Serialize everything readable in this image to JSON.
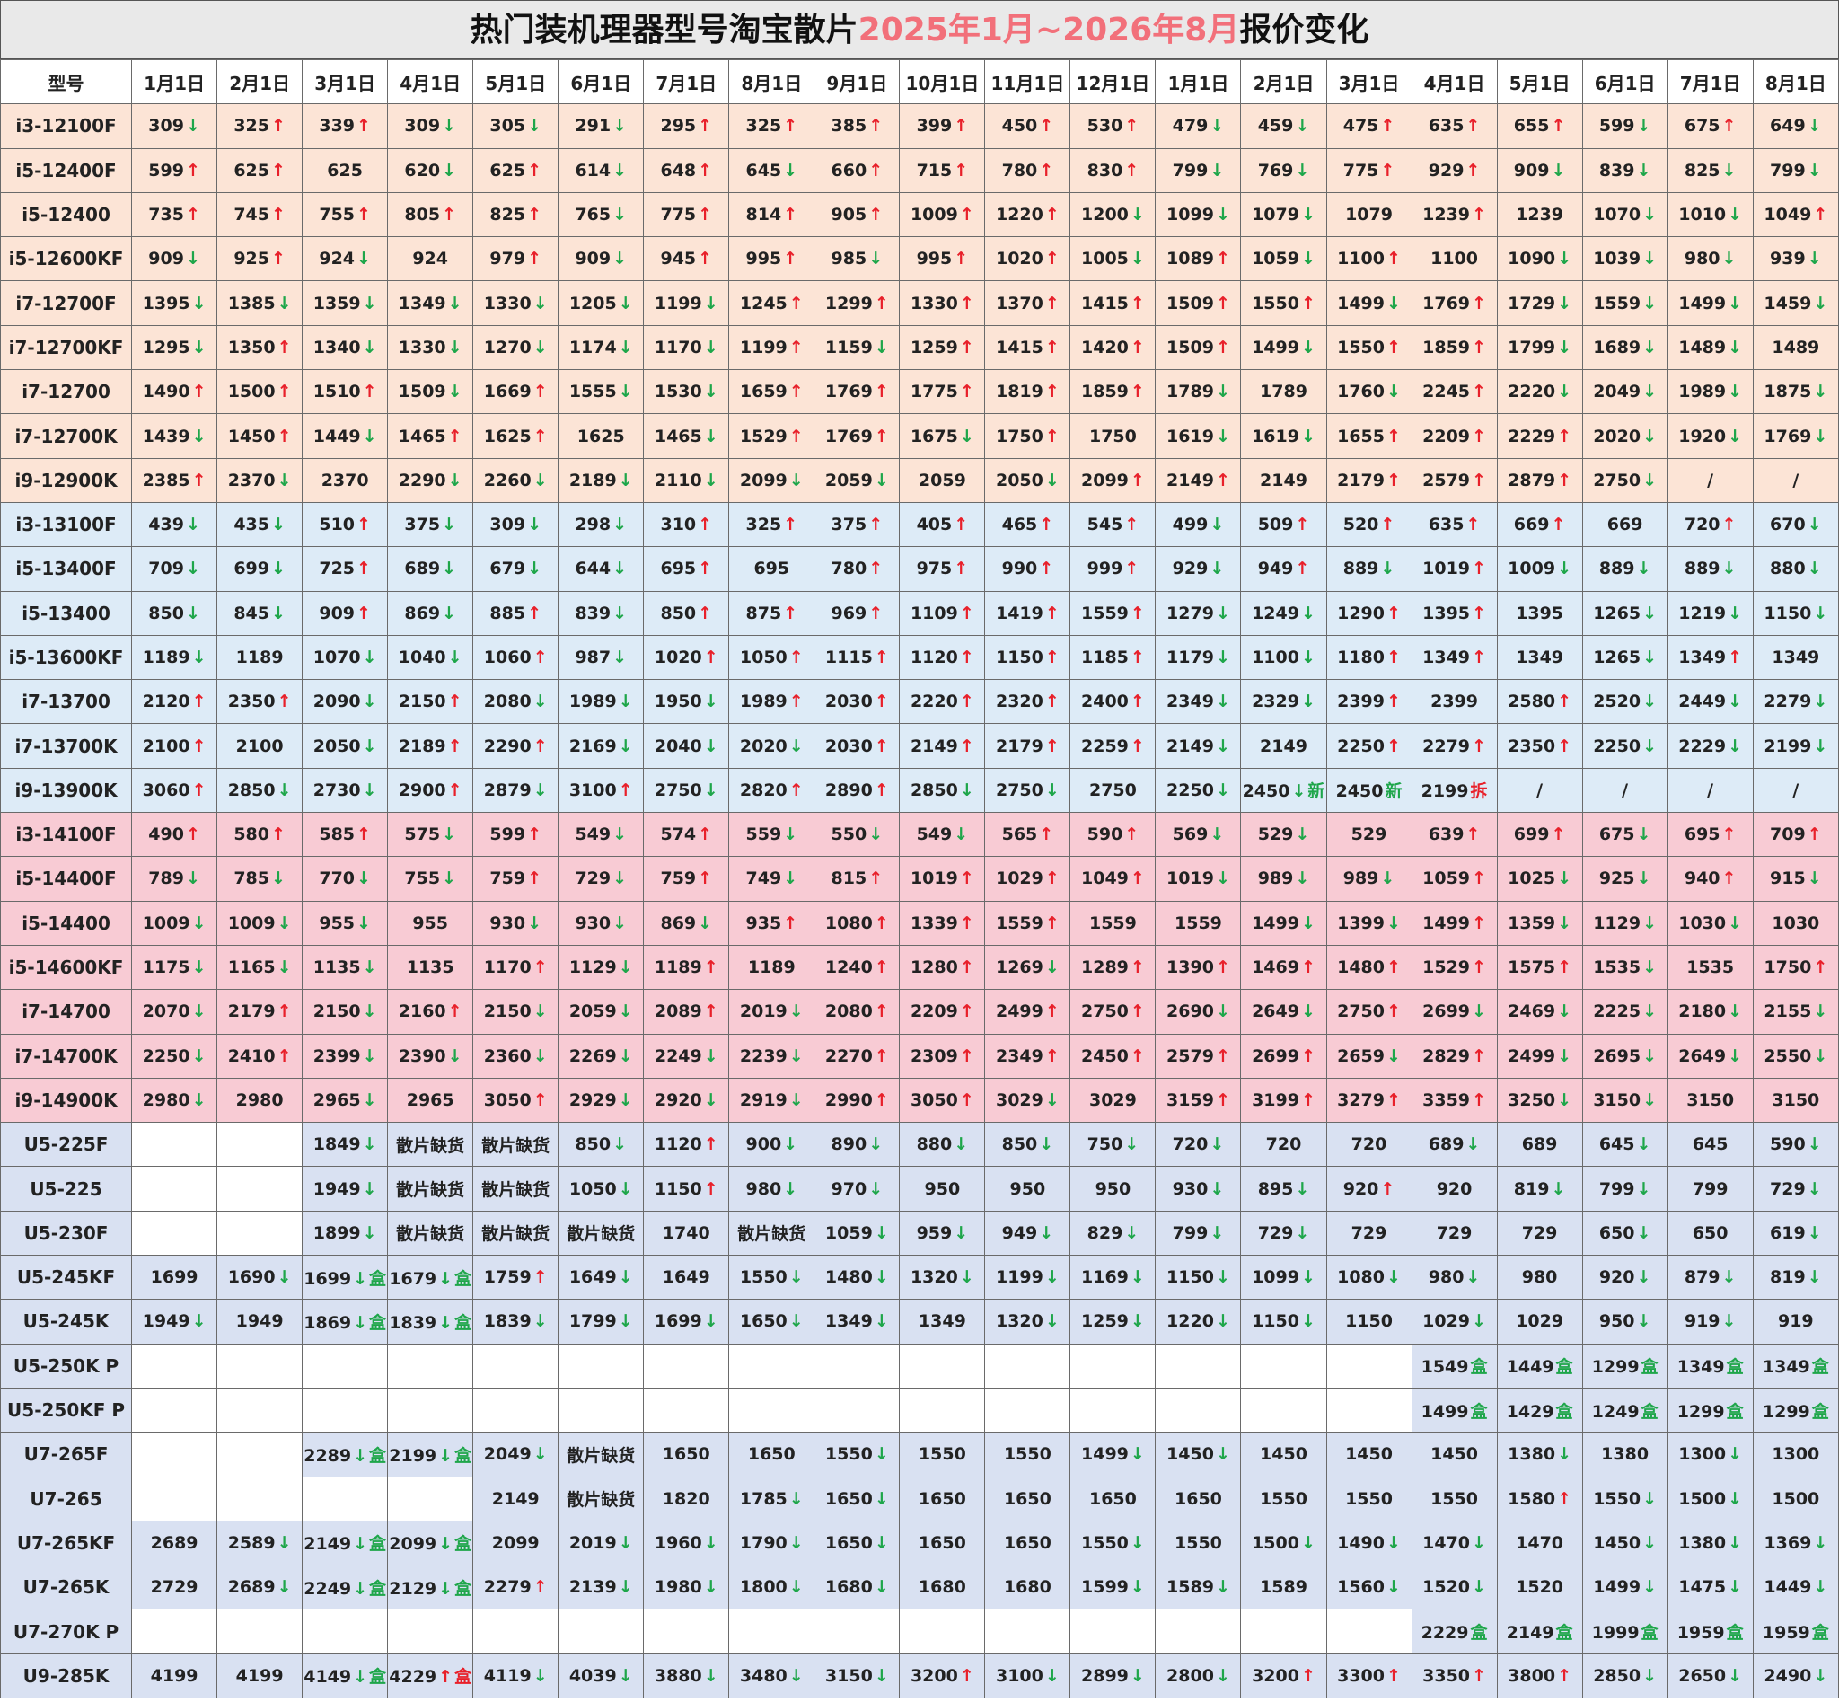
{
  "title": {
    "part1": "热门装机理器型号淘宝散片",
    "part2": "2025年1月~2026年8月",
    "part3": "报价变化"
  },
  "columns": [
    "型号",
    "1月1日",
    "2月1日",
    "3月1日",
    "4月1日",
    "5月1日",
    "6月1日",
    "7月1日",
    "8月1日",
    "9月1日",
    "10月1日",
    "11月1日",
    "12月1日",
    "1月1日",
    "2月1日",
    "3月1日",
    "4月1日",
    "5月1日",
    "6月1日",
    "7月1日",
    "8月1日"
  ],
  "rows": [
    {
      "model": "i3-12100F",
      "group": "g12",
      "cells": [
        "309↓",
        "325↑",
        "339↑",
        "309↓",
        "305↓",
        "291↓",
        "295↑",
        "325↑",
        "385↑",
        "399↑",
        "450↑",
        "530↑",
        "479↓",
        "459↓",
        "475↑",
        "635↑",
        "655↑",
        "599↓",
        "675↑",
        "649↓"
      ]
    },
    {
      "model": "i5-12400F",
      "group": "g12",
      "cells": [
        "599↑",
        "625↑",
        "625",
        "620↓",
        "625↑",
        "614↓",
        "648↑",
        "645↓",
        "660↑",
        "715↑",
        "780↑",
        "830↑",
        "799↓",
        "769↓",
        "775↑",
        "929↑",
        "909↓",
        "839↓",
        "825↓",
        "799↓"
      ]
    },
    {
      "model": "i5-12400",
      "group": "g12",
      "cells": [
        "735↑",
        "745↑",
        "755↑",
        "805↑",
        "825↑",
        "765↓",
        "775↑",
        "814↑",
        "905↑",
        "1009↑",
        "1220↑",
        "1200↓",
        "1099↓",
        "1079↓",
        "1079",
        "1239↑",
        "1239",
        "1070↓",
        "1010↓",
        "1049↑"
      ]
    },
    {
      "model": "i5-12600KF",
      "group": "g12",
      "cells": [
        "909↓",
        "925↑",
        "924↓",
        "924",
        "979↑",
        "909↓",
        "945↑",
        "995↑",
        "985↓",
        "995↑",
        "1020↑",
        "1005↓",
        "1089↑",
        "1059↓",
        "1100↑",
        "1100",
        "1090↓",
        "1039↓",
        "980↓",
        "939↓"
      ]
    },
    {
      "model": "i7-12700F",
      "group": "g12",
      "cells": [
        "1395↓",
        "1385↓",
        "1359↓",
        "1349↓",
        "1330↓",
        "1205↓",
        "1199↓",
        "1245↑",
        "1299↑",
        "1330↑",
        "1370↑",
        "1415↑",
        "1509↑",
        "1550↑",
        "1499↓",
        "1769↑",
        "1729↓",
        "1559↓",
        "1499↓",
        "1459↓"
      ]
    },
    {
      "model": "i7-12700KF",
      "group": "g12",
      "cells": [
        "1295↓",
        "1350↑",
        "1340↓",
        "1330↓",
        "1270↓",
        "1174↓",
        "1170↓",
        "1199↑",
        "1159↓",
        "1259↑",
        "1415↑",
        "1420↑",
        "1509↑",
        "1499↓",
        "1550↑",
        "1859↑",
        "1799↓",
        "1689↓",
        "1489↓",
        "1489"
      ]
    },
    {
      "model": "i7-12700",
      "group": "g12",
      "cells": [
        "1490↑",
        "1500↑",
        "1510↑",
        "1509↓",
        "1669↑",
        "1555↓",
        "1530↓",
        "1659↑",
        "1769↑",
        "1775↑",
        "1819↑",
        "1859↑",
        "1789↓",
        "1789",
        "1760↓",
        "2245↑",
        "2220↓",
        "2049↓",
        "1989↓",
        "1875↓"
      ]
    },
    {
      "model": "i7-12700K",
      "group": "g12",
      "cells": [
        "1439↓",
        "1450↑",
        "1449↓",
        "1465↑",
        "1625↑",
        "1625",
        "1465↓",
        "1529↑",
        "1769↑",
        "1675↓",
        "1750↑",
        "1750",
        "1619↓",
        "1619↓",
        "1655↑",
        "2209↑",
        "2229↑",
        "2020↓",
        "1920↓",
        "1769↓"
      ]
    },
    {
      "model": "i9-12900K",
      "group": "g12",
      "cells": [
        "2385↑",
        "2370↓",
        "2370",
        "2290↓",
        "2260↓",
        "2189↓",
        "2110↓",
        "2099↓",
        "2059↓",
        "2059",
        "2050↓",
        "2099↑",
        "2149↑",
        "2149",
        "2179↑",
        "2579↑",
        "2879↑",
        "2750↓",
        "/",
        "/"
      ]
    },
    {
      "model": "i3-13100F",
      "group": "g13",
      "cells": [
        "439↓",
        "435↓",
        "510↑",
        "375↓",
        "309↓",
        "298↓",
        "310↑",
        "325↑",
        "375↑",
        "405↑",
        "465↑",
        "545↑",
        "499↓",
        "509↑",
        "520↑",
        "635↑",
        "669↑",
        "669",
        "720↑",
        "670↓"
      ]
    },
    {
      "model": "i5-13400F",
      "group": "g13",
      "cells": [
        "709↓",
        "699↓",
        "725↑",
        "689↓",
        "679↓",
        "644↓",
        "695↑",
        "695",
        "780↑",
        "975↑",
        "990↑",
        "999↑",
        "929↓",
        "949↑",
        "889↓",
        "1019↑",
        "1009↓",
        "889↓",
        "889↓",
        "880↓"
      ]
    },
    {
      "model": "i5-13400",
      "group": "g13",
      "cells": [
        "850↓",
        "845↓",
        "909↑",
        "869↓",
        "885↑",
        "839↓",
        "850↑",
        "875↑",
        "969↑",
        "1109↑",
        "1419↑",
        "1559↑",
        "1279↓",
        "1249↓",
        "1290↑",
        "1395↑",
        "1395",
        "1265↓",
        "1219↓",
        "1150↓"
      ]
    },
    {
      "model": "i5-13600KF",
      "group": "g13",
      "cells": [
        "1189↓",
        "1189",
        "1070↓",
        "1040↓",
        "1060↑",
        "987↓",
        "1020↑",
        "1050↑",
        "1115↑",
        "1120↑",
        "1150↑",
        "1185↑",
        "1179↓",
        "1100↓",
        "1180↑",
        "1349↑",
        "1349",
        "1265↓",
        "1349↑",
        "1349"
      ]
    },
    {
      "model": "i7-13700",
      "group": "g13",
      "cells": [
        "2120↑",
        "2350↑",
        "2090↓",
        "2150↑",
        "2080↓",
        "1989↓",
        "1950↓",
        "1989↑",
        "2030↑",
        "2220↑",
        "2320↑",
        "2400↑",
        "2349↓",
        "2329↓",
        "2399↑",
        "2399",
        "2580↑",
        "2520↓",
        "2449↓",
        "2279↓"
      ]
    },
    {
      "model": "i7-13700K",
      "group": "g13",
      "cells": [
        "2100↑",
        "2100",
        "2050↓",
        "2189↑",
        "2290↑",
        "2169↓",
        "2040↓",
        "2020↓",
        "2030↑",
        "2149↑",
        "2179↑",
        "2259↑",
        "2149↓",
        "2149",
        "2250↑",
        "2279↑",
        "2350↑",
        "2250↓",
        "2229↓",
        "2199↓"
      ]
    },
    {
      "model": "i9-13900K",
      "group": "g13",
      "cells": [
        "3060↑",
        "2850↓",
        "2730↓",
        "2900↑",
        "2879↓",
        "3100↑",
        "2750↓",
        "2820↑",
        "2890↑",
        "2850↓",
        "2750↓",
        "2750",
        "2250↓",
        "2450↓新",
        "2450新",
        "2199拆",
        "/",
        "/",
        "/",
        "/"
      ]
    },
    {
      "model": "i3-14100F",
      "group": "g14",
      "cells": [
        "490↑",
        "580↑",
        "585↑",
        "575↓",
        "599↑",
        "549↓",
        "574↑",
        "559↓",
        "550↓",
        "549↓",
        "565↑",
        "590↑",
        "569↓",
        "529↓",
        "529",
        "639↑",
        "699↑",
        "675↓",
        "695↑",
        "709↑"
      ]
    },
    {
      "model": "i5-14400F",
      "group": "g14",
      "cells": [
        "789↓",
        "785↓",
        "770↓",
        "755↓",
        "759↑",
        "729↓",
        "759↑",
        "749↓",
        "815↑",
        "1019↑",
        "1029↑",
        "1049↑",
        "1019↓",
        "989↓",
        "989↓",
        "1059↑",
        "1025↓",
        "925↓",
        "940↑",
        "915↓"
      ]
    },
    {
      "model": "i5-14400",
      "group": "g14",
      "cells": [
        "1009↓",
        "1009↓",
        "955↓",
        "955",
        "930↓",
        "930↓",
        "869↓",
        "935↑",
        "1080↑",
        "1339↑",
        "1559↑",
        "1559",
        "1559",
        "1499↓",
        "1399↓",
        "1499↑",
        "1359↓",
        "1129↓",
        "1030↓",
        "1030"
      ]
    },
    {
      "model": "i5-14600KF",
      "group": "g14",
      "cells": [
        "1175↓",
        "1165↓",
        "1135↓",
        "1135",
        "1170↑",
        "1129↓",
        "1189↑",
        "1189",
        "1240↑",
        "1280↑",
        "1269↓",
        "1289↑",
        "1390↑",
        "1469↑",
        "1480↑",
        "1529↑",
        "1575↑",
        "1535↓",
        "1535",
        "1750↑"
      ]
    },
    {
      "model": "i7-14700",
      "group": "g14",
      "cells": [
        "2070↓",
        "2179↑",
        "2150↓",
        "2160↑",
        "2150↓",
        "2059↓",
        "2089↑",
        "2019↓",
        "2080↑",
        "2209↑",
        "2499↑",
        "2750↑",
        "2690↓",
        "2649↓",
        "2750↑",
        "2699↓",
        "2469↓",
        "2225↓",
        "2180↓",
        "2155↓"
      ]
    },
    {
      "model": "i7-14700K",
      "group": "g14",
      "cells": [
        "2250↓",
        "2410↑",
        "2399↓",
        "2390↓",
        "2360↓",
        "2269↓",
        "2249↓",
        "2239↓",
        "2270↑",
        "2309↑",
        "2349↑",
        "2450↑",
        "2579↑",
        "2699↑",
        "2659↓",
        "2829↑",
        "2499↓",
        "2695↓",
        "2649↓",
        "2550↓"
      ]
    },
    {
      "model": "i9-14900K",
      "group": "g14",
      "cells": [
        "2980↓",
        "2980",
        "2965↓",
        "2965",
        "3050↑",
        "2929↓",
        "2920↓",
        "2919↓",
        "2990↑",
        "3050↑",
        "3029↓",
        "3029",
        "3159↑",
        "3199↑",
        "3279↑",
        "3359↑",
        "3250↓",
        "3150↓",
        "3150",
        "3150"
      ]
    },
    {
      "model": "U5-225F",
      "group": "gu",
      "cells": [
        "",
        "",
        "1849↓",
        "散片缺货",
        "散片缺货",
        "850↓",
        "1120↑",
        "900↓",
        "890↓",
        "880↓",
        "850↓",
        "750↓",
        "720↓",
        "720",
        "720",
        "689↓",
        "689",
        "645↓",
        "645",
        "590↓"
      ]
    },
    {
      "model": "U5-225",
      "group": "gu",
      "cells": [
        "",
        "",
        "1949↓",
        "散片缺货",
        "散片缺货",
        "1050↓",
        "1150↑",
        "980↓",
        "970↓",
        "950",
        "950",
        "950",
        "930↓",
        "895↓",
        "920↑",
        "920",
        "819↓",
        "799↓",
        "799",
        "729↓"
      ]
    },
    {
      "model": "U5-230F",
      "group": "gu",
      "cells": [
        "",
        "",
        "1899↓",
        "散片缺货",
        "散片缺货",
        "散片缺货",
        "1740",
        "散片缺货",
        "1059↓",
        "959↓",
        "949↓",
        "829↓",
        "799↓",
        "729↓",
        "729",
        "729",
        "729",
        "650↓",
        "650",
        "619↓"
      ]
    },
    {
      "model": "U5-245KF",
      "group": "gu",
      "cells": [
        "1699",
        "1690↓",
        "1699↓盒",
        "1679↓盒",
        "1759↑",
        "1649↓",
        "1649",
        "1550↓",
        "1480↓",
        "1320↓",
        "1199↓",
        "1169↓",
        "1150↓",
        "1099↓",
        "1080↓",
        "980↓",
        "980",
        "920↓",
        "879↓",
        "819↓"
      ]
    },
    {
      "model": "U5-245K",
      "group": "gu",
      "cells": [
        "1949↓",
        "1949",
        "1869↓盒",
        "1839↓盒",
        "1839↓",
        "1799↓",
        "1699↓",
        "1650↓",
        "1349↓",
        "1349",
        "1320↓",
        "1259↓",
        "1220↓",
        "1150↓",
        "1150",
        "1029↓",
        "1029",
        "950↓",
        "919↓",
        "919"
      ]
    },
    {
      "model": "U5-250K P",
      "group": "gu",
      "cells": [
        "",
        "",
        "",
        "",
        "",
        "",
        "",
        "",
        "",
        "",
        "",
        "",
        "",
        "",
        "",
        "1549盒",
        "1449盒",
        "1299盒",
        "1349盒",
        "1349盒"
      ]
    },
    {
      "model": "U5-250KF P",
      "group": "gu",
      "cells": [
        "",
        "",
        "",
        "",
        "",
        "",
        "",
        "",
        "",
        "",
        "",
        "",
        "",
        "",
        "",
        "1499盒",
        "1429盒",
        "1249盒",
        "1299盒",
        "1299盒"
      ]
    },
    {
      "model": "U7-265F",
      "group": "gu",
      "cells": [
        "",
        "",
        "2289↓盒",
        "2199↓盒",
        "2049↓",
        "散片缺货",
        "1650",
        "1650",
        "1550↓",
        "1550",
        "1550",
        "1499↓",
        "1450↓",
        "1450",
        "1450",
        "1450",
        "1380↓",
        "1380",
        "1300↓",
        "1300"
      ]
    },
    {
      "model": "U7-265",
      "group": "gu",
      "cells": [
        "",
        "",
        "",
        "",
        "2149",
        "散片缺货",
        "1820",
        "1785↓",
        "1650↓",
        "1650",
        "1650",
        "1650",
        "1650",
        "1550",
        "1550",
        "1550",
        "1580↑",
        "1550↓",
        "1500↓",
        "1500"
      ]
    },
    {
      "model": "U7-265KF",
      "group": "gu",
      "cells": [
        "2689",
        "2589↓",
        "2149↓盒",
        "2099↓盒",
        "2099",
        "2019↓",
        "1960↓",
        "1790↓",
        "1650↓",
        "1650",
        "1650",
        "1550↓",
        "1550",
        "1500↓",
        "1490↓",
        "1470↓",
        "1470",
        "1450↓",
        "1380↓",
        "1369↓"
      ]
    },
    {
      "model": "U7-265K",
      "group": "gu",
      "cells": [
        "2729",
        "2689↓",
        "2249↓盒",
        "2129↓盒",
        "2279↑",
        "2139↓",
        "1980↓",
        "1800↓",
        "1680↓",
        "1680",
        "1680",
        "1599↓",
        "1589↓",
        "1589",
        "1560↓",
        "1520↓",
        "1520",
        "1499↓",
        "1475↓",
        "1449↓"
      ]
    },
    {
      "model": "U7-270K P",
      "group": "gu",
      "cells": [
        "",
        "",
        "",
        "",
        "",
        "",
        "",
        "",
        "",
        "",
        "",
        "",
        "",
        "",
        "",
        "2229盒",
        "2149盒",
        "1999盒",
        "1959盒",
        "1959盒"
      ]
    },
    {
      "model": "U9-285K",
      "group": "gu",
      "cells": [
        "4199",
        "4199",
        "4149↓盒",
        "4229↑盒",
        "4119↓",
        "4039↓",
        "3880↓",
        "3480↓",
        "3150↓",
        "3200↑",
        "3100↓",
        "2899↓",
        "2800↓",
        "3200↑",
        "3300↑",
        "3350↑",
        "3800↑",
        "2850↓",
        "2650↓",
        "2490↓"
      ]
    }
  ],
  "colors": {
    "up": "#e8202a",
    "down": "#1ea64a",
    "title_highlight": "#f2707a",
    "row_12th": "#fce4d6",
    "row_13th": "#ddebf7",
    "row_14th": "#f8cbd4",
    "row_ultra": "#d9e1f2"
  }
}
